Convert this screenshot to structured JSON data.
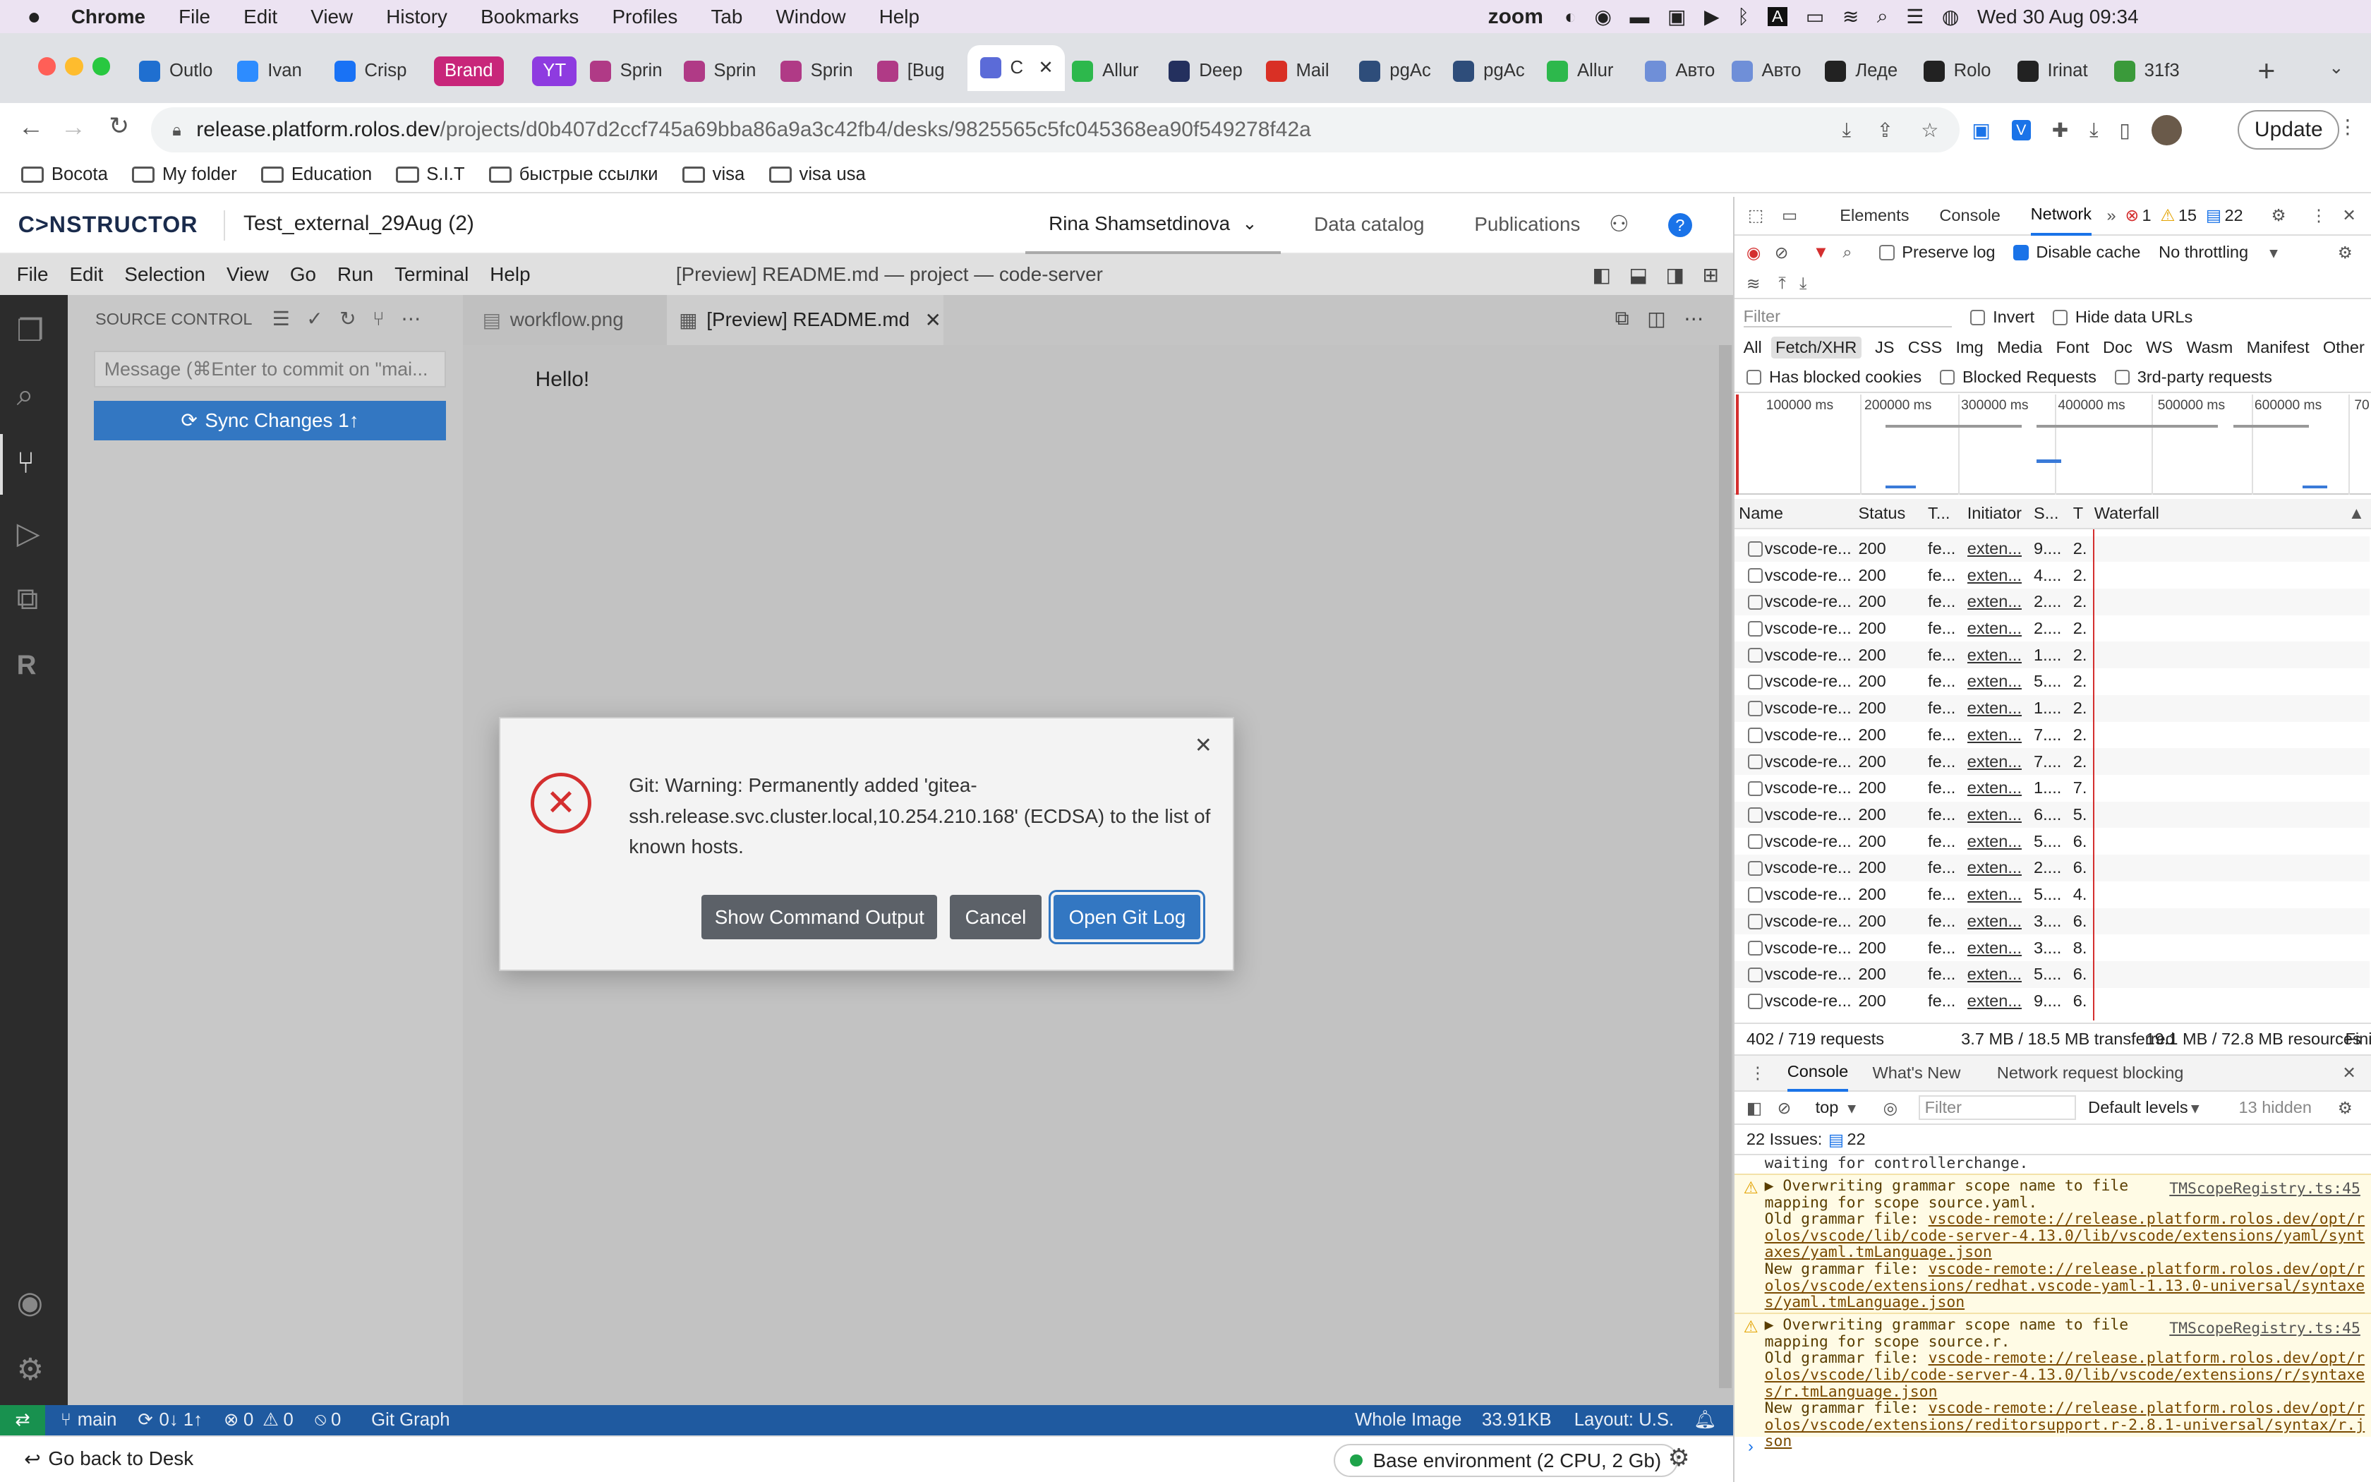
{
  "macbar": {
    "apple_icon": "apple-icon",
    "app": "Chrome",
    "menus": [
      "File",
      "Edit",
      "View",
      "History",
      "Bookmarks",
      "Profiles",
      "Tab",
      "Window",
      "Help"
    ],
    "zoom_label": "zoom",
    "clock": "Wed 30 Aug  09:34"
  },
  "tabs": [
    {
      "label": "Outlo",
      "color": "#1f6fd0"
    },
    {
      "label": "Ivan",
      "color": "#2d8cff"
    },
    {
      "label": "Crisp",
      "color": "#1972f5"
    },
    {
      "label": "Brand",
      "color": "#c8267a",
      "badge": true
    },
    {
      "label": "YT",
      "color": "#8e3be0",
      "badge": true
    },
    {
      "label": "Sprin",
      "color": "#b03a86"
    },
    {
      "label": "Sprin",
      "color": "#b03a86"
    },
    {
      "label": "Sprin",
      "color": "#b03a86"
    },
    {
      "label": "[Bug",
      "color": "#b03a86"
    },
    {
      "label": "C",
      "color": "#5b6bd8",
      "active": true
    },
    {
      "label": "Allur",
      "color": "#2db84c"
    },
    {
      "label": "Deep",
      "color": "#24305e"
    },
    {
      "label": "Mail",
      "color": "#d93025"
    },
    {
      "label": "pgAc",
      "color": "#2e4d7a"
    },
    {
      "label": "pgAc",
      "color": "#2e4d7a"
    },
    {
      "label": "Allur",
      "color": "#2db84c"
    },
    {
      "label": "Авто",
      "color": "#6f8fd8"
    },
    {
      "label": "Авто",
      "color": "#6f8fd8"
    },
    {
      "label": "Леде",
      "color": "#222222"
    },
    {
      "label": "Rolo",
      "color": "#222222"
    },
    {
      "label": "Irinat",
      "color": "#222222"
    },
    {
      "label": "31f3",
      "color": "#3a9a3a"
    }
  ],
  "address": {
    "domain": "release.platform.rolos.dev",
    "path": "/projects/d0b407d2ccf745a69bba86a9a3c42fb4/desks/9825565c5fc045368ea90f549278f42a",
    "update_label": "Update"
  },
  "bookmarks": [
    "Bocota",
    "My folder",
    "Education",
    "S.I.T",
    "быстрые ссылки",
    "visa",
    "visa usa"
  ],
  "constructor": {
    "logo": "C>NSTRUCTOR",
    "project": "Test_external_29Aug (2)",
    "user": "Rina Shamsetdinova",
    "nav": [
      "Data catalog",
      "Publications"
    ]
  },
  "vscode": {
    "menus": [
      "File",
      "Edit",
      "Selection",
      "View",
      "Go",
      "Run",
      "Terminal",
      "Help"
    ],
    "window_title": "[Preview] README.md — project — code-server",
    "sidebar_title": "SOURCE CONTROL",
    "commit_placeholder": "Message (⌘Enter to commit on \"mai...",
    "sync_label": "Sync Changes 1↑",
    "tabs": [
      {
        "label": "workflow.png",
        "active": false
      },
      {
        "label": "[Preview] README.md",
        "active": true
      }
    ],
    "preview_text": "Hello!"
  },
  "dialog": {
    "message": "Git: Warning: Permanently added 'gitea-ssh.release.svc.cluster.local,10.254.210.168' (ECDSA) to the list of known hosts.",
    "buttons": [
      "Show Command Output",
      "Cancel",
      "Open Git Log"
    ]
  },
  "status": {
    "branch": "main",
    "sync": "0↓ 1↑",
    "problems": "0",
    "warnings": "0",
    "ports": "0",
    "git_graph": "Git Graph",
    "right": [
      "Whole Image",
      "33.91KB",
      "Layout: U.S."
    ]
  },
  "bottom": {
    "back": "Go back to Desk",
    "env": "Base environment (2 CPU, 2 Gb)"
  },
  "devtools": {
    "tabs": [
      "Elements",
      "Console",
      "Network"
    ],
    "errors": "1",
    "warnings": "15",
    "messages": "22",
    "preserve_log": "Preserve log",
    "disable_cache": "Disable cache",
    "throttling": "No throttling",
    "filter_placeholder": "Filter",
    "invert": "Invert",
    "hide_data_urls": "Hide data URLs",
    "types": [
      "All",
      "Fetch/XHR",
      "JS",
      "CSS",
      "Img",
      "Media",
      "Font",
      "Doc",
      "WS",
      "Wasm",
      "Manifest",
      "Other"
    ],
    "has_blocked_cookies": "Has blocked cookies",
    "blocked_requests": "Blocked Requests",
    "third_party": "3rd-party requests",
    "timeline_ticks": [
      "100000 ms",
      "200000 ms",
      "300000 ms",
      "400000 ms",
      "500000 ms",
      "600000 ms",
      "70"
    ],
    "columns": [
      "Name",
      "Status",
      "T...",
      "Initiator",
      "S...",
      "T",
      "Waterfall"
    ],
    "rows": [
      {
        "name": "vscode-re...",
        "status": "200",
        "type": "fe...",
        "initiator": "exten...",
        "size": "9....",
        "time": "2."
      },
      {
        "name": "vscode-re...",
        "status": "200",
        "type": "fe...",
        "initiator": "exten...",
        "size": "4....",
        "time": "2."
      },
      {
        "name": "vscode-re...",
        "status": "200",
        "type": "fe...",
        "initiator": "exten...",
        "size": "2....",
        "time": "2."
      },
      {
        "name": "vscode-re...",
        "status": "200",
        "type": "fe...",
        "initiator": "exten...",
        "size": "2....",
        "time": "2."
      },
      {
        "name": "vscode-re...",
        "status": "200",
        "type": "fe...",
        "initiator": "exten...",
        "size": "1....",
        "time": "2."
      },
      {
        "name": "vscode-re...",
        "status": "200",
        "type": "fe...",
        "initiator": "exten...",
        "size": "5....",
        "time": "2."
      },
      {
        "name": "vscode-re...",
        "status": "200",
        "type": "fe...",
        "initiator": "exten...",
        "size": "1....",
        "time": "2."
      },
      {
        "name": "vscode-re...",
        "status": "200",
        "type": "fe...",
        "initiator": "exten...",
        "size": "7....",
        "time": "2."
      },
      {
        "name": "vscode-re...",
        "status": "200",
        "type": "fe...",
        "initiator": "exten...",
        "size": "7....",
        "time": "2."
      },
      {
        "name": "vscode-re...",
        "status": "200",
        "type": "fe...",
        "initiator": "exten...",
        "size": "1....",
        "time": "7."
      },
      {
        "name": "vscode-re...",
        "status": "200",
        "type": "fe...",
        "initiator": "exten...",
        "size": "6....",
        "time": "5."
      },
      {
        "name": "vscode-re...",
        "status": "200",
        "type": "fe...",
        "initiator": "exten...",
        "size": "5....",
        "time": "6."
      },
      {
        "name": "vscode-re...",
        "status": "200",
        "type": "fe...",
        "initiator": "exten...",
        "size": "2....",
        "time": "6."
      },
      {
        "name": "vscode-re...",
        "status": "200",
        "type": "fe...",
        "initiator": "exten...",
        "size": "5....",
        "time": "4."
      },
      {
        "name": "vscode-re...",
        "status": "200",
        "type": "fe...",
        "initiator": "exten...",
        "size": "3....",
        "time": "6."
      },
      {
        "name": "vscode-re...",
        "status": "200",
        "type": "fe...",
        "initiator": "exten...",
        "size": "3....",
        "time": "8."
      },
      {
        "name": "vscode-re...",
        "status": "200",
        "type": "fe...",
        "initiator": "exten...",
        "size": "5....",
        "time": "6."
      },
      {
        "name": "vscode-re...",
        "status": "200",
        "type": "fe...",
        "initiator": "exten...",
        "size": "9....",
        "time": "6."
      }
    ],
    "summary": [
      "402 / 719 requests",
      "3.7 MB / 18.5 MB transferred",
      "19.1 MB / 72.8 MB resources",
      "Fini"
    ],
    "drawer_tabs": [
      "Console",
      "What's New",
      "Network request blocking"
    ],
    "context": "top",
    "console_filter": "Filter",
    "levels": "Default levels",
    "hidden": "13 hidden",
    "issues_label": "22 Issues:",
    "issues_count": "22",
    "log_top": "waiting for controllerchange.",
    "logs": [
      {
        "title": "Overwriting grammar scope name to file mapping for scope source.yaml.",
        "source": "TMScopeRegistry.ts:45",
        "old_label": "Old grammar file: ",
        "old": "vscode-remote://release.platform.rolos.dev/opt/rolos/vscode/lib/code-server-4.13.0/lib/vscode/extensions/yaml/syntaxes/yaml.tmLanguage.json",
        "new_label": "New grammar file: ",
        "new": "vscode-remote://release.platform.rolos.dev/opt/rolos/vscode/extensions/redhat.vscode-yaml-1.13.0-universal/syntaxes/yaml.tmLanguage.json"
      },
      {
        "title": "Overwriting grammar scope name to file mapping for scope source.r.",
        "source": "TMScopeRegistry.ts:45",
        "old_label": "Old grammar file: ",
        "old": "vscode-remote://release.platform.rolos.dev/opt/rolos/vscode/lib/code-server-4.13.0/lib/vscode/extensions/r/syntaxes/r.tmLanguage.json",
        "new_label": "New grammar file: ",
        "new": "vscode-remote://release.platform.rolos.dev/opt/rolos/vscode/extensions/reditorsupport.r-2.8.1-universal/syntax/r.json"
      }
    ]
  },
  "colors": {
    "accent": "#1a73e8",
    "vscode_blue": "#3377c2",
    "status_bar": "#1f5aa0",
    "error_red": "#d42f2f"
  }
}
